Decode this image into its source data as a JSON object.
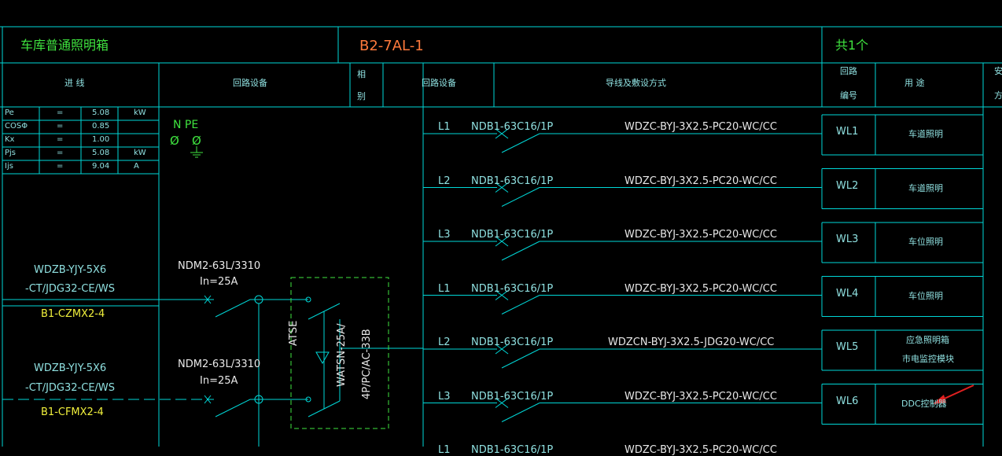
{
  "header": {
    "box_name": "车库普通照明箱",
    "box_code": "B2-7AL-1",
    "quantity": "共1个"
  },
  "column_headers": {
    "incoming": "进  线",
    "circuit_equipment_1": "回路设备",
    "phase_1": "相",
    "phase_2": "别",
    "circuit_equipment_2": "回路设备",
    "wiring": "导线及敷设方式",
    "circuit_no_1": "回路",
    "circuit_no_2": "编号",
    "usage": "用  途",
    "install_1": "安",
    "install_2": "方"
  },
  "load_table": [
    {
      "param": "Pe",
      "eq": "=",
      "value": "5.08",
      "unit": "kW"
    },
    {
      "param": "COSΦ",
      "eq": "=",
      "value": "0.85",
      "unit": ""
    },
    {
      "param": "Kx",
      "eq": "=",
      "value": "1.00",
      "unit": ""
    },
    {
      "param": "Pjs",
      "eq": "=",
      "value": "5.08",
      "unit": "kW"
    },
    {
      "param": "Ijs",
      "eq": "=",
      "value": "9.04",
      "unit": "A"
    }
  ],
  "npe": {
    "label": "N PE",
    "n_symbol": "Ø",
    "pe_symbol": "Ø"
  },
  "incoming_feeders": [
    {
      "cable_1": "WDZB-YJY-5X6",
      "cable_2": "-CT/JDG32-CE/WS",
      "source": "B1-CZMX2-4",
      "breaker_model": "NDM2-63L/3310",
      "breaker_rating": "In=25A"
    },
    {
      "cable_1": "WDZB-YJY-5X6",
      "cable_2": "-CT/JDG32-CE/WS",
      "source": "B1-CFMX2-4",
      "breaker_model": "NDM2-63L/3310",
      "breaker_rating": "In=25A"
    }
  ],
  "ats": {
    "label": "ATSE",
    "model_1": "WATSN-25A/",
    "model_2": "4P/PC/AC-33B"
  },
  "circuits": [
    {
      "phase": "L1",
      "breaker": "NDB1-63C16/1P",
      "wiring": "WDZC-BYJ-3X2.5-PC20-WC/CC",
      "number": "WL1",
      "usage": "车道照明",
      "usage_2": ""
    },
    {
      "phase": "L2",
      "breaker": "NDB1-63C16/1P",
      "wiring": "WDZC-BYJ-3X2.5-PC20-WC/CC",
      "number": "WL2",
      "usage": "车道照明",
      "usage_2": ""
    },
    {
      "phase": "L3",
      "breaker": "NDB1-63C16/1P",
      "wiring": "WDZC-BYJ-3X2.5-PC20-WC/CC",
      "number": "WL3",
      "usage": "车位照明",
      "usage_2": ""
    },
    {
      "phase": "L1",
      "breaker": "NDB1-63C16/1P",
      "wiring": "WDZC-BYJ-3X2.5-PC20-WC/CC",
      "number": "WL4",
      "usage": "车位照明",
      "usage_2": ""
    },
    {
      "phase": "L2",
      "breaker": "NDB1-63C16/1P",
      "wiring": "WDZCN-BYJ-3X2.5-JDG20-WC/CC",
      "number": "WL5",
      "usage": "应急照明箱",
      "usage_2": "市电监控模块"
    },
    {
      "phase": "L3",
      "breaker": "NDB1-63C16/1P",
      "wiring": "WDZC-BYJ-3X2.5-PC20-WC/CC",
      "number": "WL6",
      "usage": "DDC控制器",
      "usage_2": ""
    },
    {
      "phase": "L1",
      "breaker": "NDB1-63C16/1P",
      "wiring": "WDZC-BYJ-3X2.5-PC20-WC/CC",
      "number": "",
      "usage": "",
      "usage_2": ""
    }
  ],
  "colors": {
    "line": "#00d7d7",
    "text_cyan": "#8fe0e0",
    "text_green": "#3fe33f",
    "text_orange": "#ff7a3c",
    "text_yellow": "#f0f03c",
    "dashed_green": "#3fe33f",
    "arrow_red": "#e02020",
    "background": "#000000"
  }
}
